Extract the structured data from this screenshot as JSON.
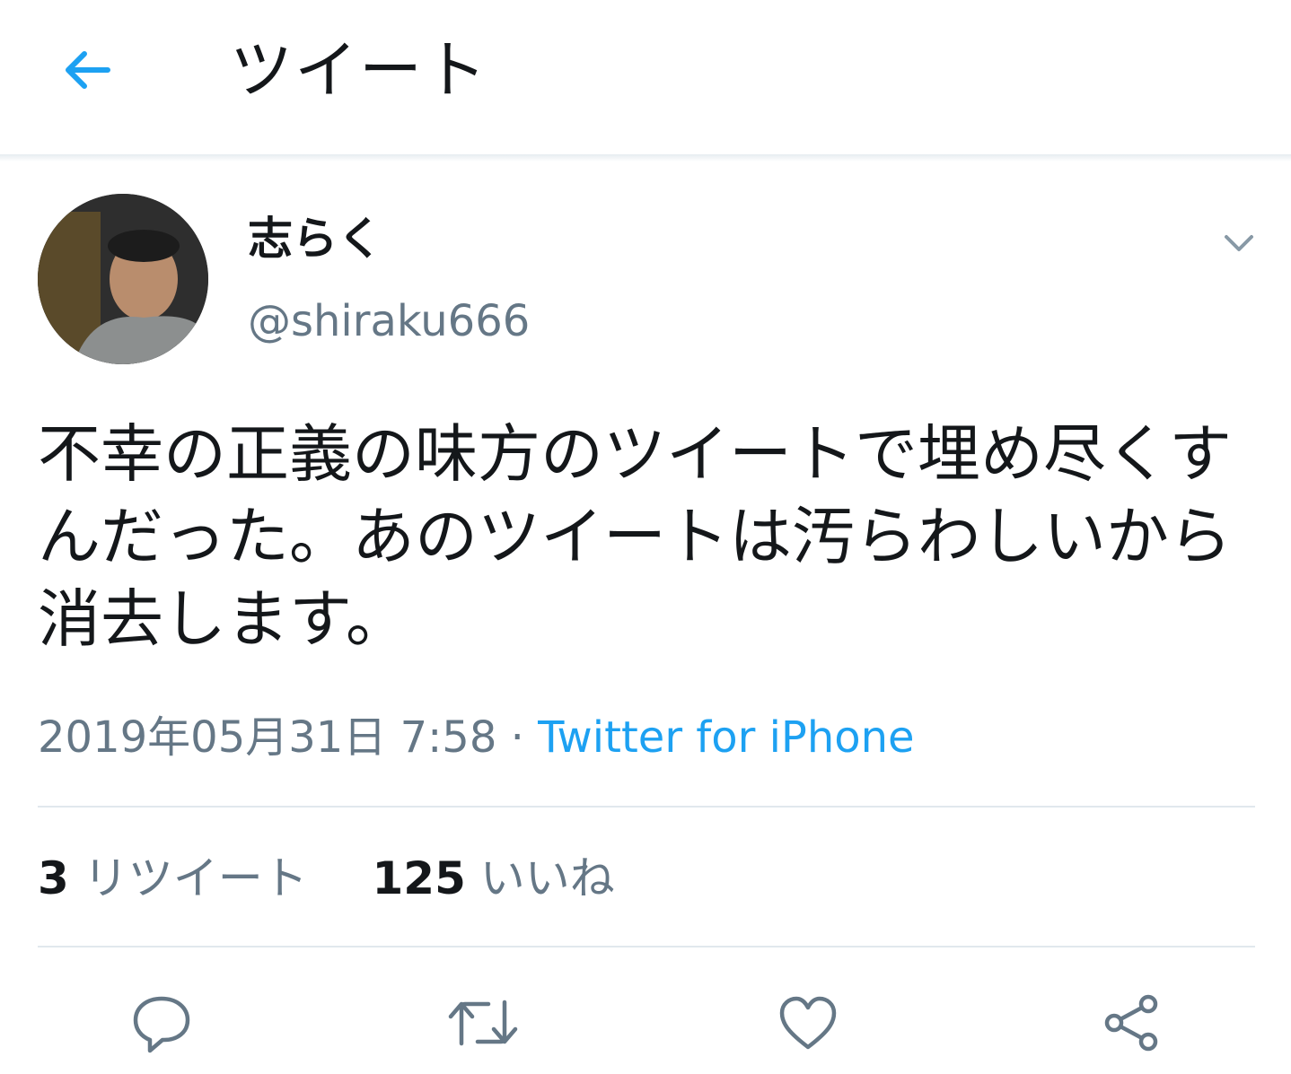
{
  "header": {
    "title": "ツイート",
    "back_icon": "arrow-left-icon"
  },
  "tweet": {
    "author_name": "志らく",
    "author_handle": "@shiraku666",
    "text": "不幸の正義の味方のツイートで埋め尽くすんだった。あのツイートは汚らわしいから消去します。",
    "timestamp": "2019年05月31日 7:58",
    "separator": "·",
    "source": "Twitter for iPhone"
  },
  "stats": {
    "retweets_count": "3",
    "retweets_label": "リツイート",
    "likes_count": "125",
    "likes_label": "いいね"
  },
  "actions": [
    "reply-icon",
    "retweet-icon",
    "like-icon",
    "share-icon"
  ],
  "colors": {
    "accent": "#1da1f2",
    "secondary_text": "#657786",
    "divider": "#e1e8ed"
  }
}
